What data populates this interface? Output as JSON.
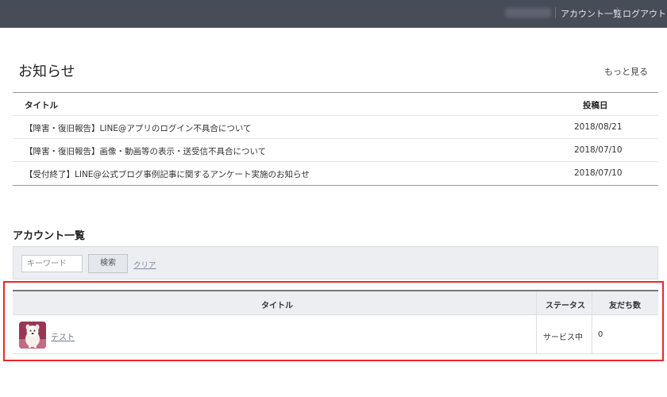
{
  "header": {
    "account_list_link": "アカウント一覧",
    "logout_link": "ログアウト"
  },
  "notices": {
    "title": "お知らせ",
    "more_link": "もっと見る",
    "columns": {
      "title": "タイトル",
      "date": "投稿日"
    },
    "rows": [
      {
        "title": "【障害・復旧報告】LINE@アプリのログイン不具合について",
        "date": "2018/08/21"
      },
      {
        "title": "【障害・復旧報告】画像・動画等の表示・送受信不具合について",
        "date": "2018/07/10"
      },
      {
        "title": "【受付終了】LINE@公式ブログ事例記事に関するアンケート実施のお知らせ",
        "date": "2018/07/10"
      }
    ]
  },
  "accounts": {
    "title": "アカウント一覧",
    "search": {
      "placeholder": "キーワード",
      "value": "",
      "button_label": "検索",
      "clear_label": "クリア"
    },
    "columns": {
      "title": "タイトル",
      "status": "ステータス",
      "friends": "友だち数"
    },
    "rows": [
      {
        "name": "テスト",
        "status": "サービス中",
        "friends": "0",
        "avatar_icon": "dog-photo-avatar"
      }
    ]
  },
  "colors": {
    "topbar": "#464c58",
    "highlight_border": "#e8292b",
    "link": "#6a7a96"
  }
}
